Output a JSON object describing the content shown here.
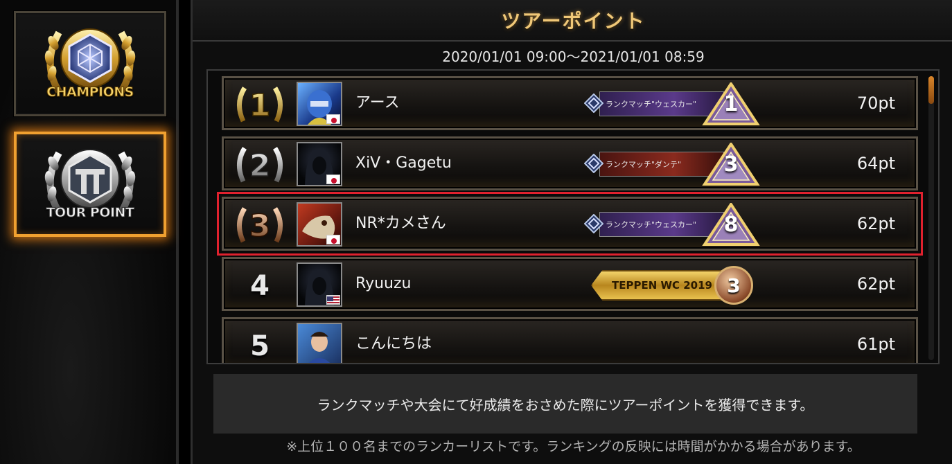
{
  "sidebar": {
    "buttons": [
      {
        "label": "CHAMPIONS",
        "icon": "champions-emblem-icon",
        "active": false
      },
      {
        "label": "TOUR POINT",
        "icon": "tour-point-emblem-icon",
        "active": true
      }
    ]
  },
  "header": {
    "title": "ツアーポイント",
    "period": "2020/01/01 09:00～2021/01/01 08:59"
  },
  "ranking": {
    "rows": [
      {
        "rank": "1",
        "name": "アース",
        "points": "70pt",
        "flag": "jp",
        "badge_type": "rank",
        "badge_text": "ランクマッチ\"ウェスカー\"",
        "badge_num": "1",
        "badge_color": "purple"
      },
      {
        "rank": "2",
        "name": "XiV・Gagetu",
        "points": "64pt",
        "flag": "jp",
        "badge_type": "rank",
        "badge_text": "ランクマッチ\"ダンテ\"",
        "badge_num": "3",
        "badge_color": "red"
      },
      {
        "rank": "3",
        "name": "NR*カメさん",
        "points": "62pt",
        "flag": "jp",
        "badge_type": "rank",
        "badge_text": "ランクマッチ\"ウェスカー\"",
        "badge_num": "8",
        "badge_color": "purple",
        "highlighted": true
      },
      {
        "rank": "4",
        "name": "Ryuuzu",
        "points": "62pt",
        "flag": "us",
        "badge_type": "wc",
        "badge_text": "TEPPEN WC 2019",
        "badge_num": "3"
      },
      {
        "rank": "5",
        "name": "こんにちは",
        "points": "61pt",
        "flag": "",
        "badge_type": "none"
      }
    ]
  },
  "info": {
    "message": "ランクマッチや大会にて好成績をおさめた際にツアーポイントを獲得できます。",
    "footnote": "※上位１００名までのランカーリストです。ランキングの反映には時間がかかる場合があります。"
  },
  "colors": {
    "accent_orange": "#f0a030",
    "highlight_red": "#e0212e",
    "title_gold": "#f0c878"
  }
}
